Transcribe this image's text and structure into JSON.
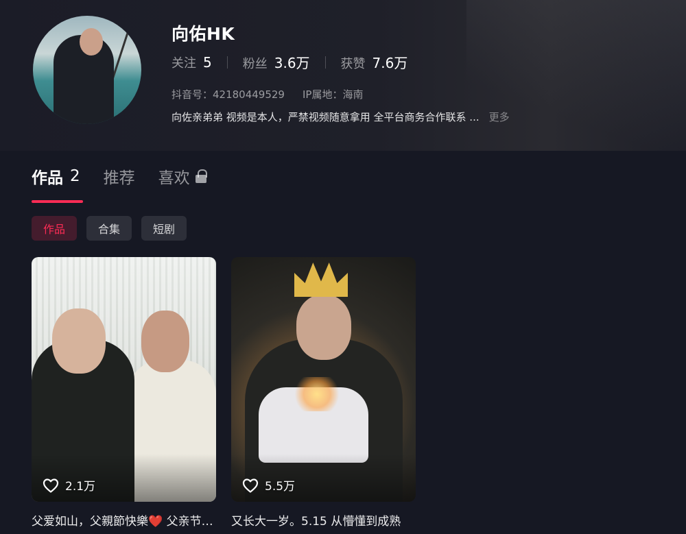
{
  "profile": {
    "nickname": "向佑HK",
    "stats": [
      {
        "label": "关注",
        "value": "5"
      },
      {
        "label": "粉丝",
        "value": "3.6万"
      },
      {
        "label": "获赞",
        "value": "7.6万"
      }
    ],
    "douyin_id": "抖音号：42180449529",
    "ip_location": "IP属地：海南",
    "bio": "向佐亲弟弟 视频是本人，严禁视频随意拿用 全平台商务合作联系 ...",
    "more_label": "更多"
  },
  "tabs": [
    {
      "label": "作品",
      "count": "2",
      "active": true
    },
    {
      "label": "推荐"
    },
    {
      "label": "喜欢",
      "locked": true
    }
  ],
  "chips": [
    "作品",
    "合集",
    "短剧"
  ],
  "videos": [
    {
      "likes": "2.1万",
      "caption": "父爱如山，父親節快樂❤️ 父亲节快乐"
    },
    {
      "likes": "5.5万",
      "caption": "又长大一岁。5.15 从懵懂到成熟"
    }
  ],
  "colors": {
    "accent": "#fe2c55",
    "background": "#161823"
  }
}
